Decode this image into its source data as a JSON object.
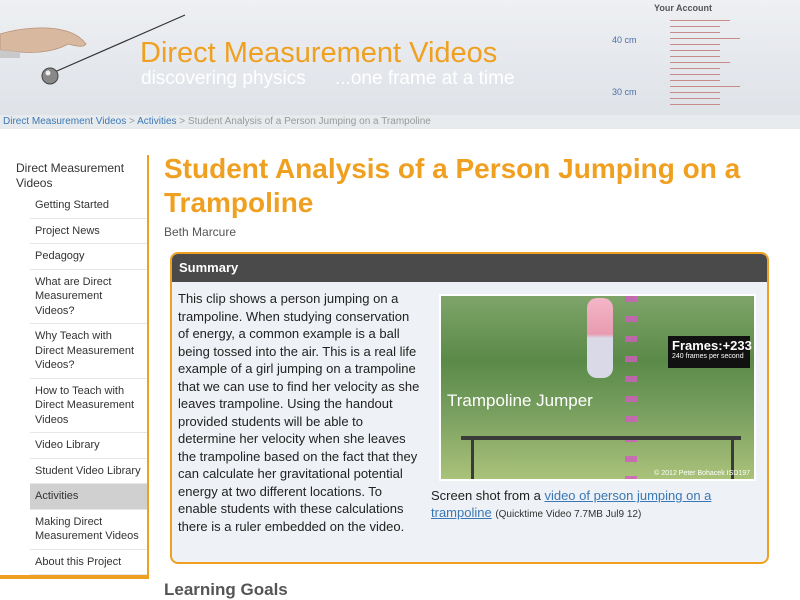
{
  "header": {
    "account_link": "Your Account",
    "site_title": "Direct Measurement Videos",
    "tagline_left": "discovering physics",
    "tagline_right": "...one frame at a time",
    "ruler_label_top": "40 cm",
    "ruler_label_bottom": "30 cm"
  },
  "breadcrumb": {
    "items": [
      "Direct Measurement Videos",
      "Activities"
    ],
    "separator": ">",
    "current": "Student Analysis of a Person Jumping on a Trampoline"
  },
  "sidebar": {
    "heading": "Direct Measurement Videos",
    "items": [
      {
        "label": "Getting Started"
      },
      {
        "label": "Project News"
      },
      {
        "label": "Pedagogy"
      },
      {
        "label": "What are Direct Measurement Videos?"
      },
      {
        "label": "Why Teach with Direct Measurement Videos?"
      },
      {
        "label": "How to Teach with Direct Measurement Videos"
      },
      {
        "label": "Video Library"
      },
      {
        "label": "Student Video Library"
      },
      {
        "label": "Activities"
      },
      {
        "label": "Making Direct Measurement Videos"
      },
      {
        "label": "About this Project"
      }
    ],
    "active_item": "Activities"
  },
  "main": {
    "title": "Student Analysis of a Person Jumping on a Trampoline",
    "author": "Beth Marcure",
    "summary_heading": "Summary",
    "summary_text": "This clip shows a person jumping on a trampoline. When studying conservation of energy, a common example is a ball being tossed into the air. This is a real life example of a girl jumping on a trampoline that we can use to find her velocity as she leaves trampoline. Using the handout provided students will be able to determine her velocity when she leaves the trampoline based on the fact that they can calculate her gravitational potential energy at two different locations. To enable students with these calculations there is a ruler embedded on the video.",
    "video": {
      "overlay_label": "Trampoline Jumper",
      "frames_label": "Frames:+233",
      "fps_label": "240 frames per second",
      "copyright": "© 2012 Peter Bohacek ISD197"
    },
    "caption_prefix": "Screen shot from a ",
    "caption_link": "video of person jumping on a trampoline",
    "caption_meta": "(Quicktime Video 7.7MB Jul9 12)",
    "next_section": "Learning Goals"
  },
  "colors": {
    "accent_orange": "#f0a020",
    "link_blue": "#3a78b5",
    "summary_header": "#4a4a4a"
  }
}
